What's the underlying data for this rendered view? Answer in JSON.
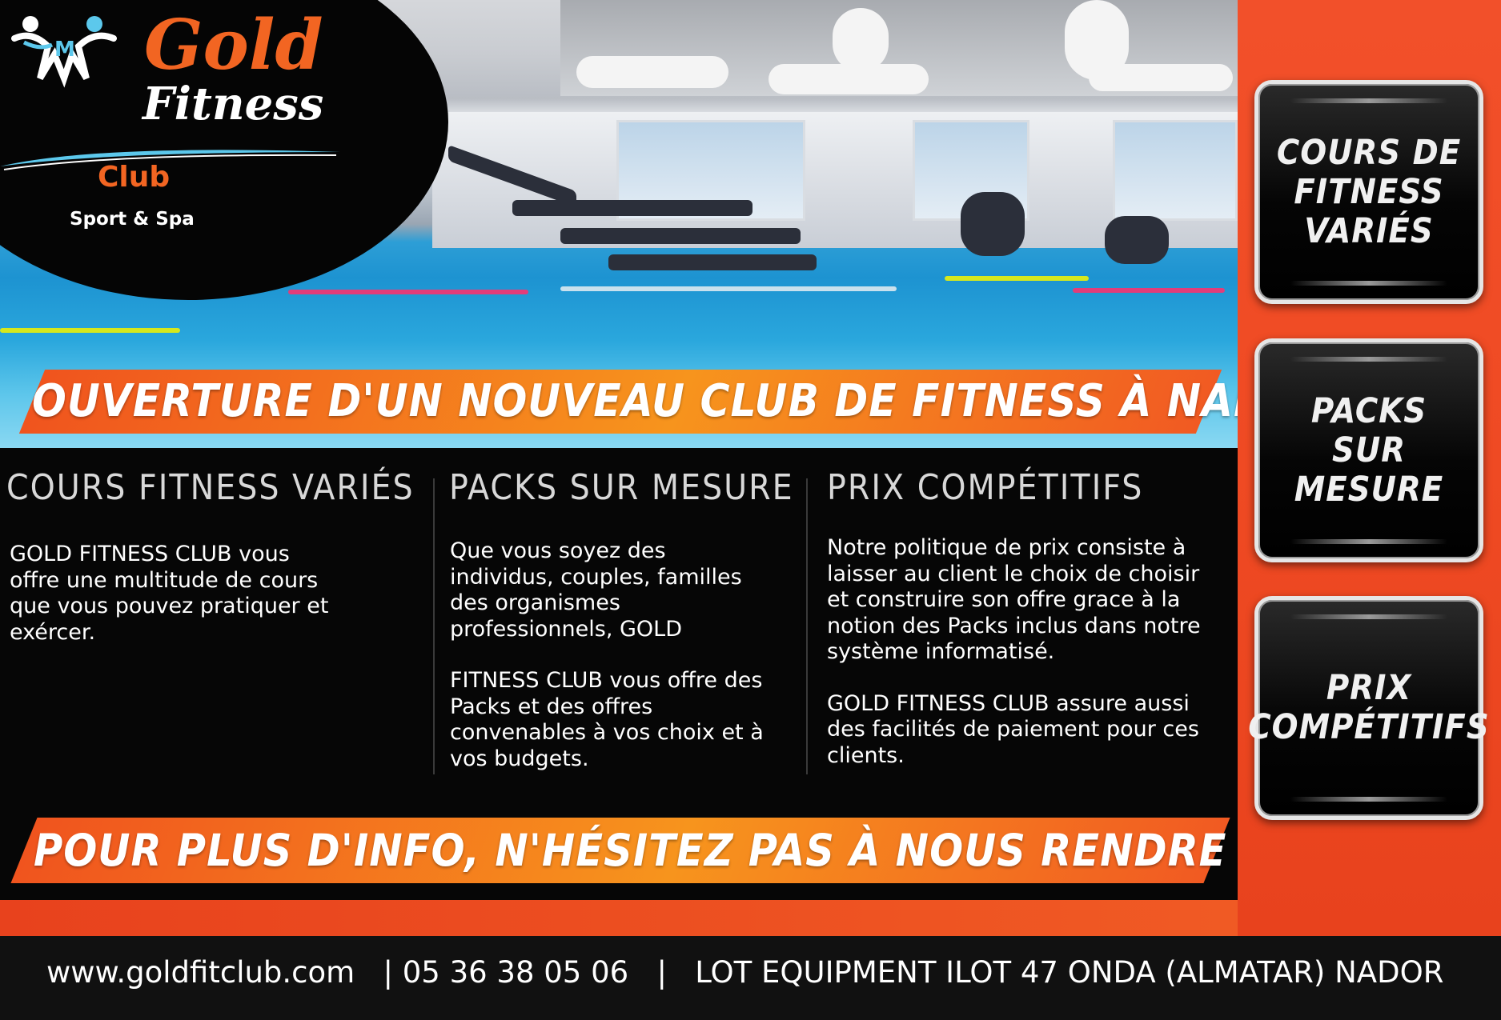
{
  "brand": {
    "name_line1": "Gold",
    "name_line2": "Fitness",
    "club": "Club",
    "tagline": "Sport & Spa",
    "accent_color": "#f26522"
  },
  "headline": "OUVERTURE D'UN NOUVEAU CLUB DE FITNESS À NADOR",
  "columns": [
    {
      "title": "COURS FITNESS VARIÉS",
      "paragraphs": [
        "GOLD FITNESS CLUB vous offre une multitude de cours que vous pouvez pratiquer et exércer."
      ]
    },
    {
      "title": "PACKS SUR MESURE",
      "paragraphs": [
        "Que vous soyez des individus, couples, familles des organismes professionnels, GOLD",
        " FITNESS CLUB vous offre des Packs et des offres convenables à vos choix et à vos budgets."
      ]
    },
    {
      "title": "PRIX COMPÉTITIFS",
      "paragraphs": [
        "Notre politique de prix consiste à laisser au client le choix de choisir et construire son offre grace à la notion des Packs inclus dans notre système informatisé.",
        "GOLD FITNESS CLUB assure aussi des facilités de paiement pour ces clients."
      ]
    }
  ],
  "cta": "POUR PLUS D'INFO, N'HÉSITEZ PAS À NOUS RENDRE VISITE",
  "sidebar": {
    "boxes": [
      {
        "lines": [
          "COURS DE",
          "FITNESS",
          "VARIÉS"
        ]
      },
      {
        "lines": [
          "PACKS",
          "SUR MESURE"
        ]
      },
      {
        "lines": [
          "PRIX",
          "COMPÉTITIFS"
        ]
      }
    ]
  },
  "footer": {
    "website": "www.goldfitclub.com",
    "phone": "05 36 38 05 06",
    "address": "LOT EQUIPMENT ILOT 47 ONDA (ALMATAR) NADOR",
    "separator": "|"
  },
  "colors": {
    "orange": "#f05a24",
    "orange_light": "#f7941d",
    "black": "#060606",
    "pool_blue": "#1d93d1"
  }
}
